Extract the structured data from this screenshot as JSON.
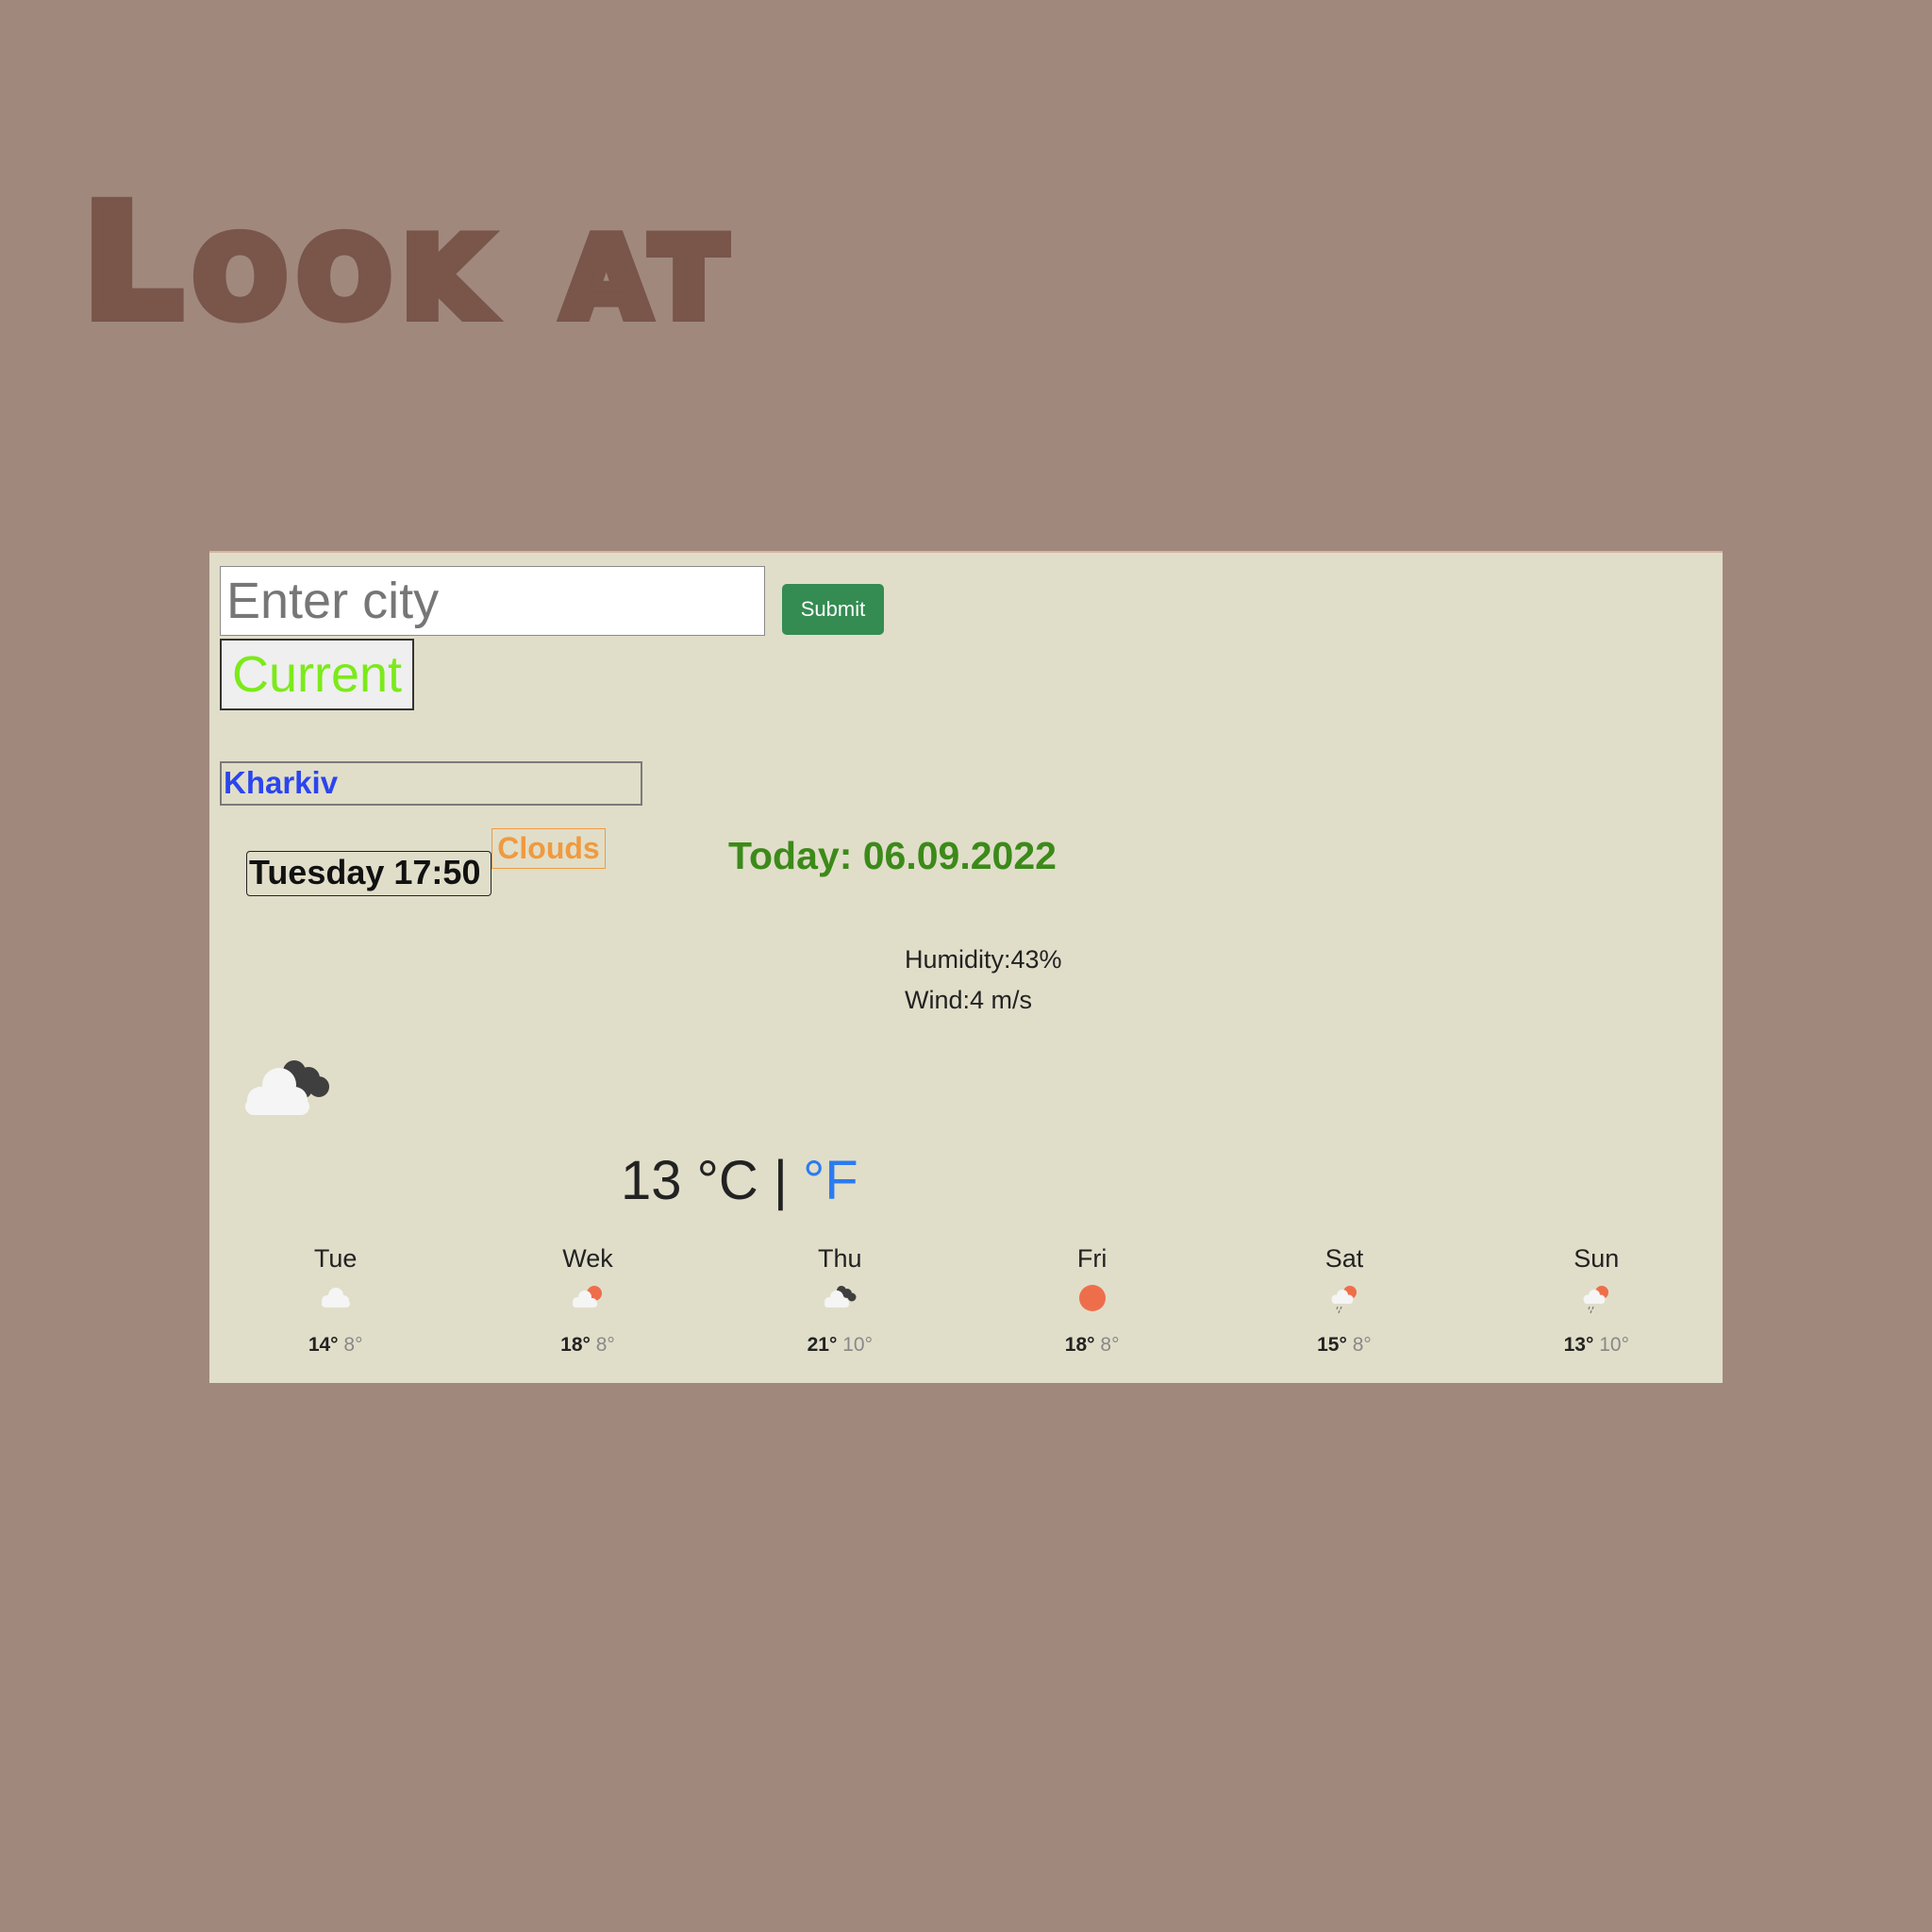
{
  "header": {
    "title": "Look at"
  },
  "search": {
    "placeholder": "Enter city",
    "submit_label": "Submit",
    "current_label": "Current"
  },
  "weather": {
    "city": "Kharkiv",
    "datetime": "Tuesday 17:50",
    "description": "Clouds",
    "today": "Today: 06.09.2022",
    "humidity": "Humidity:43%",
    "wind": "Wind:4 m/s",
    "temperature": "13",
    "unit_c": "°C",
    "separator": "|",
    "unit_f": "°F",
    "icon": "dark-clouds-icon"
  },
  "forecast": [
    {
      "day": "Tue",
      "max": "14°",
      "min": "8°",
      "icon": "cloud-icon"
    },
    {
      "day": "Wek",
      "max": "18°",
      "min": "8°",
      "icon": "sun-cloud-icon"
    },
    {
      "day": "Thu",
      "max": "21°",
      "min": "10°",
      "icon": "dark-clouds-icon"
    },
    {
      "day": "Fri",
      "max": "18°",
      "min": "8°",
      "icon": "sun-icon"
    },
    {
      "day": "Sat",
      "max": "15°",
      "min": "8°",
      "icon": "sun-rain-icon"
    },
    {
      "day": "Sun",
      "max": "13°",
      "min": "10°",
      "icon": "sun-rain-icon"
    }
  ],
  "colors": {
    "background": "#a0887d",
    "title": "#79554a",
    "card": "#e0dec9",
    "submit": "#348c52",
    "current_text": "#7cea1a",
    "city": "#2b45ee",
    "description": "#f09a3f",
    "today": "#3c8a1a",
    "fahrenheit": "#2b7bf0",
    "sun": "#ee6e4b"
  }
}
